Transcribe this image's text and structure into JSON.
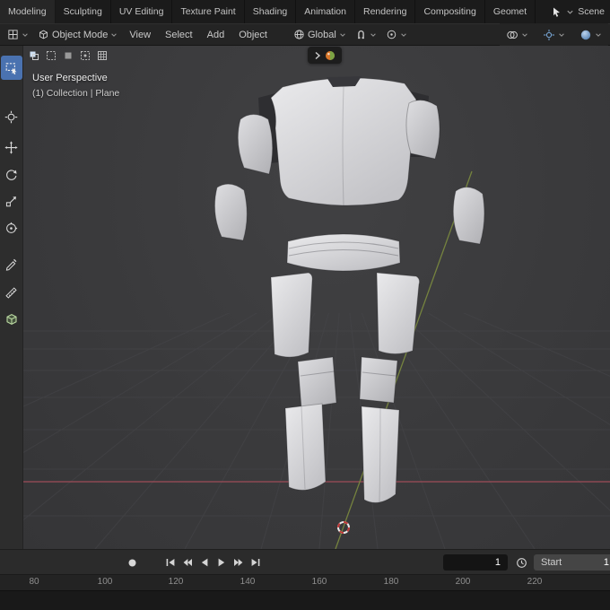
{
  "topbar": {
    "tabs": [
      "Modeling",
      "Sculpting",
      "UV Editing",
      "Texture Paint",
      "Shading",
      "Animation",
      "Rendering",
      "Compositing",
      "Geomet"
    ],
    "scene_label": "Scene"
  },
  "header": {
    "mode_label": "Object Mode",
    "menus": [
      "View",
      "Select",
      "Add",
      "Object"
    ],
    "orientation_label": "Global"
  },
  "viewport": {
    "view_label": "User Perspective",
    "context_label": "(1) Collection | Plane"
  },
  "timeline": {
    "current_frame": "1",
    "start_label": "Start",
    "start_value": "1",
    "ruler_marks": [
      "80",
      "100",
      "120",
      "140",
      "160",
      "180",
      "200",
      "220"
    ]
  },
  "tools": [
    "select-box",
    "cursor",
    "move",
    "rotate",
    "scale",
    "transform",
    "annotate",
    "measure",
    "add-cube"
  ],
  "icons": {
    "editor_type": "grid-icon",
    "mode": "cube-icon",
    "orientation": "globe-icon",
    "snap": "magnet-icon",
    "proportional": "circle-icon",
    "overlays": "overlapping-circles-icon",
    "gizmo": "gizmo-icon",
    "shading": "sphere-icon",
    "record": "record-dot-icon",
    "clock": "clock-icon",
    "preview": "material-sphere-icon"
  },
  "colors": {
    "accent": "#4a72b0",
    "axis_x": "#b0505e",
    "axis_y": "#7c8b3f",
    "model": "#d6d6d8",
    "header_bg": "#242424",
    "viewport_bg": "#3a3a3c"
  }
}
